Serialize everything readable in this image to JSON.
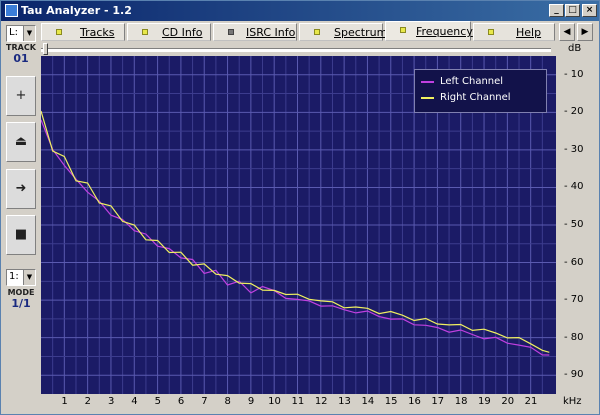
{
  "window": {
    "title": "Tau Analyzer - 1.2"
  },
  "sidebar": {
    "track_combo": "L:",
    "track_label": "TRACK",
    "track_value": "01",
    "buttons": [
      {
        "name": "add",
        "glyph": "+"
      },
      {
        "name": "eject",
        "glyph": "⏏"
      },
      {
        "name": "play",
        "glyph": "➜"
      },
      {
        "name": "stop",
        "glyph": "■"
      }
    ],
    "mode_combo": "1:",
    "mode_label": "MODE",
    "mode_value": "1/1"
  },
  "tabs": [
    {
      "label": "Tracks",
      "led": "on"
    },
    {
      "label": "CD Info",
      "led": "on"
    },
    {
      "label": "ISRC Info",
      "led": "off"
    },
    {
      "label": "Spectrum",
      "led": "on"
    },
    {
      "label": "Frequency",
      "led": "on",
      "active": true
    },
    {
      "label": "Help",
      "led": "on"
    }
  ],
  "nav": {
    "prev": "◀",
    "next": "▶"
  },
  "chart_data": {
    "type": "line",
    "xlabel": "kHz",
    "ylabel": "dB",
    "xlim": [
      0,
      22
    ],
    "ylim": [
      -95,
      -5
    ],
    "x_ticks": [
      1,
      2,
      3,
      4,
      5,
      6,
      7,
      8,
      9,
      10,
      11,
      12,
      13,
      14,
      15,
      16,
      17,
      18,
      19,
      20,
      21
    ],
    "y_ticks": [
      -10,
      -20,
      -30,
      -40,
      -50,
      -60,
      -70,
      -80,
      -90
    ],
    "y_tick_labels": [
      "- 10",
      "- 20",
      "- 30",
      "- 40",
      "- 50",
      "- 60",
      "- 70",
      "- 80",
      "- 90"
    ],
    "legend_position": "top-right",
    "grid": true,
    "series": [
      {
        "name": "Left Channel",
        "color": "#c040e0",
        "x": [
          0.0,
          0.5,
          1,
          1.5,
          2,
          2.5,
          3,
          3.5,
          4,
          4.5,
          5,
          5.5,
          6,
          6.5,
          7,
          7.5,
          8,
          8.5,
          9,
          9.5,
          10,
          10.5,
          11,
          11.5,
          12,
          12.5,
          13,
          13.5,
          14,
          14.5,
          15,
          15.5,
          16,
          16.5,
          17,
          17.5,
          18,
          18.5,
          19,
          19.5,
          20,
          20.5,
          21,
          21.5,
          21.8
        ],
        "y": [
          -22,
          -30,
          -34,
          -38,
          -41,
          -44,
          -47,
          -49,
          -51,
          -53,
          -55,
          -57,
          -58,
          -60,
          -62,
          -63,
          -65,
          -66,
          -67,
          -67.5,
          -68,
          -69,
          -70,
          -70.5,
          -71,
          -72,
          -72.5,
          -73,
          -73.5,
          -74,
          -75,
          -75.5,
          -76,
          -77,
          -77.5,
          -78,
          -78.5,
          -79,
          -80,
          -80.5,
          -81,
          -82,
          -83,
          -84,
          -85
        ]
      },
      {
        "name": "Right Channel",
        "color": "#f0f060",
        "x": [
          0.0,
          0.5,
          1,
          1.5,
          2,
          2.5,
          3,
          3.5,
          4,
          4.5,
          5,
          5.5,
          6,
          6.5,
          7,
          7.5,
          8,
          8.5,
          9,
          9.5,
          10,
          10.5,
          11,
          11.5,
          12,
          12.5,
          13,
          13.5,
          14,
          14.5,
          15,
          15.5,
          16,
          16.5,
          17,
          17.5,
          18,
          18.5,
          19,
          19.5,
          20,
          20.5,
          21,
          21.5,
          21.8
        ],
        "y": [
          -21,
          -29,
          -33,
          -37,
          -40,
          -43,
          -46,
          -48,
          -51,
          -53,
          -55,
          -56.5,
          -58,
          -60,
          -61,
          -62.5,
          -64,
          -65,
          -66,
          -67,
          -67.5,
          -68,
          -69,
          -69.5,
          -70,
          -71,
          -71.5,
          -72,
          -72.5,
          -73,
          -73.5,
          -74,
          -75,
          -75.5,
          -76,
          -76.5,
          -77,
          -77.5,
          -78,
          -79,
          -79.5,
          -80.5,
          -81.5,
          -83,
          -84.5
        ]
      }
    ]
  }
}
